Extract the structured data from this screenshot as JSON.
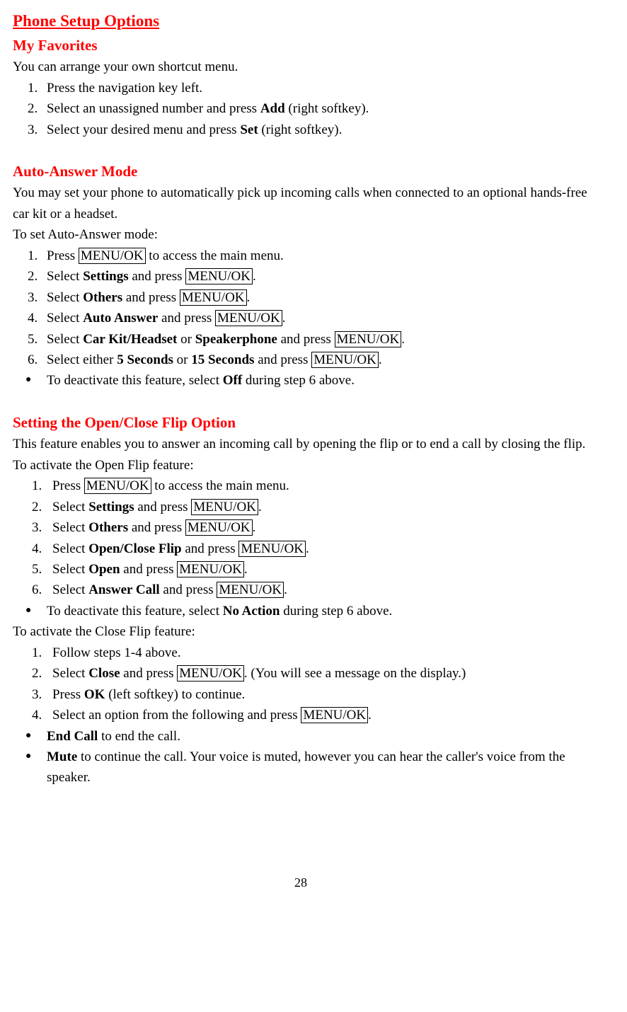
{
  "title_main": "Phone Setup Options",
  "sec1": {
    "heading": "My Favorites",
    "intro": "You can arrange your own shortcut menu.",
    "steps": {
      "s1": "Press the navigation key left.",
      "s2a": "Select an unassigned number and press ",
      "s2b": "Add",
      "s2c": " (right softkey).",
      "s3a": "Select your desired menu and press ",
      "s3b": "Set",
      "s3c": " (right softkey)."
    }
  },
  "sec2": {
    "heading": "Auto-Answer Mode",
    "intro": "You may set your phone to automatically pick up incoming calls when connected to an optional hands-free car kit or a headset.",
    "lead": "To set Auto-Answer mode:",
    "s1a": "Press ",
    "menuok": "MENU/OK",
    "s1b": " to access the main menu.",
    "s2a": "Select ",
    "settings": "Settings",
    "s2b": " and press ",
    "dot": ".",
    "s3a": "Select ",
    "others": "Others",
    "s4a": "Select ",
    "autoanswer": "Auto Answer",
    "s5a": "Select ",
    "carkit": "Car Kit/Headset",
    "or": " or ",
    "speaker": "Speakerphone",
    "s6a": "Select either ",
    "five": "5 Seconds",
    "or2": " or ",
    "fifteen": "15 Seconds",
    "b1a": "To deactivate this feature, select ",
    "off": "Off",
    "b1b": " during step 6 above."
  },
  "sec3": {
    "heading": "Setting the Open/Close Flip Option",
    "intro": "This feature enables you to answer an incoming call by opening the flip or to end a call by closing the flip.",
    "lead1": "To activate the Open Flip feature:",
    "s1a": "Press ",
    "s1b": " to access the main menu.",
    "s2a": "Select ",
    "s2b": " and press ",
    "s4_opt": "Open/Close Flip",
    "s5_opt": "Open",
    "s6_opt": "Answer Call",
    "b1a": "To deactivate this feature, select ",
    "noaction": "No Action",
    "b1b": " during step 6 above.",
    "lead2": "To activate the Close Flip feature:",
    "c1": "Follow steps 1-4 above.",
    "c2a": "Select ",
    "close": "Close",
    "c2b": " and press ",
    "c2c": ". (You will see a message on the display.)",
    "c3a": "Press ",
    "ok": "OK",
    "c3b": " (left softkey) to continue.",
    "c4a": "Select an option from the following and press ",
    "endcall": "End Call",
    "ec_tail": " to end the call.",
    "mute": "Mute",
    "mu_tail": " to continue the call. Your voice is muted, however you can hear the caller's voice from the speaker."
  },
  "page": "28"
}
